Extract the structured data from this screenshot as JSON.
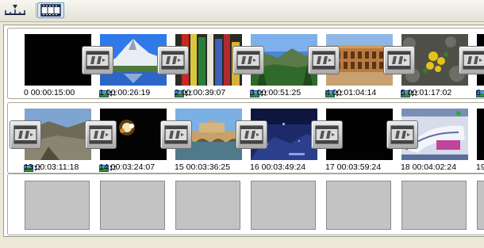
{
  "toolbar": {
    "buttons": [
      {
        "name": "timeline-view",
        "icon": "timeline-ruler-icon",
        "selected": false
      },
      {
        "name": "storyboard-view",
        "icon": "filmstrip-icon",
        "selected": true
      }
    ]
  },
  "clips": [
    {
      "index": "0",
      "time": "00:00:15:00",
      "scene": "black",
      "has_media_badge": false
    },
    {
      "index": "1",
      "time": "00:00:26:19",
      "scene": "mountain-lake",
      "has_media_badge": true
    },
    {
      "index": "2",
      "time": "00:00:39:07",
      "scene": "prayer-flags",
      "has_media_badge": true
    },
    {
      "index": "3",
      "time": "00:00:51:25",
      "scene": "green-valley",
      "has_media_badge": true
    },
    {
      "index": "4",
      "time": "00:01:04:14",
      "scene": "colosseum",
      "has_media_badge": true
    },
    {
      "index": "5",
      "time": "00:01:17:02",
      "scene": "yellow-flowers",
      "has_media_badge": true
    },
    {
      "index": "6",
      "time": "",
      "scene": "black",
      "has_media_badge": true
    },
    {
      "index": "13",
      "time": "00:03:11:18",
      "scene": "rocky-hill",
      "has_media_badge": true
    },
    {
      "index": "14",
      "time": "00:03:24:07",
      "scene": "fireball",
      "has_media_badge": true
    },
    {
      "index": "15",
      "time": "00:03:36:25",
      "scene": "castle-bridge",
      "has_media_badge": false
    },
    {
      "index": "16",
      "time": "00:03:49:24",
      "scene": "dark-blue-game",
      "has_media_badge": false
    },
    {
      "index": "17",
      "time": "00:03:59:24",
      "scene": "black",
      "has_media_badge": false
    },
    {
      "index": "18",
      "time": "00:04:02:24",
      "scene": "car-website",
      "has_media_badge": false
    },
    {
      "index": "19",
      "time": "",
      "scene": "black",
      "has_media_badge": false
    }
  ],
  "empty_slot_count": 7,
  "transition": {
    "icon": "transition-filmstrip-icon"
  }
}
